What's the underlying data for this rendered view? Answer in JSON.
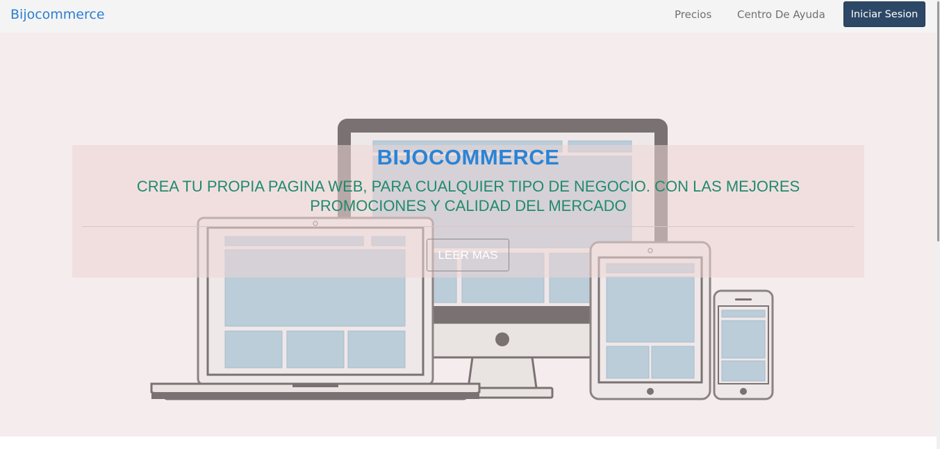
{
  "navbar": {
    "brand": "Bijocommerce",
    "links": [
      "Precios",
      "Centro De Ayuda"
    ],
    "login_label": "Iniciar Sesion"
  },
  "hero": {
    "title": "BIJOCOMMERCE",
    "subtitle": "CREA TU PROPIA PAGINA WEB, PARA CUALQUIER TIPO DE NEGOCIO. CON LAS MEJORES PROMOCIONES Y CALIDAD DEL MERCADO",
    "cta_label": "LEER MAS",
    "illustration": "responsive-devices-illustration"
  },
  "colors": {
    "brand": "#2a7ed3",
    "login_button": "#2c4866",
    "hero_background": "#f5eced",
    "subtitle": "#1f8a6e"
  }
}
